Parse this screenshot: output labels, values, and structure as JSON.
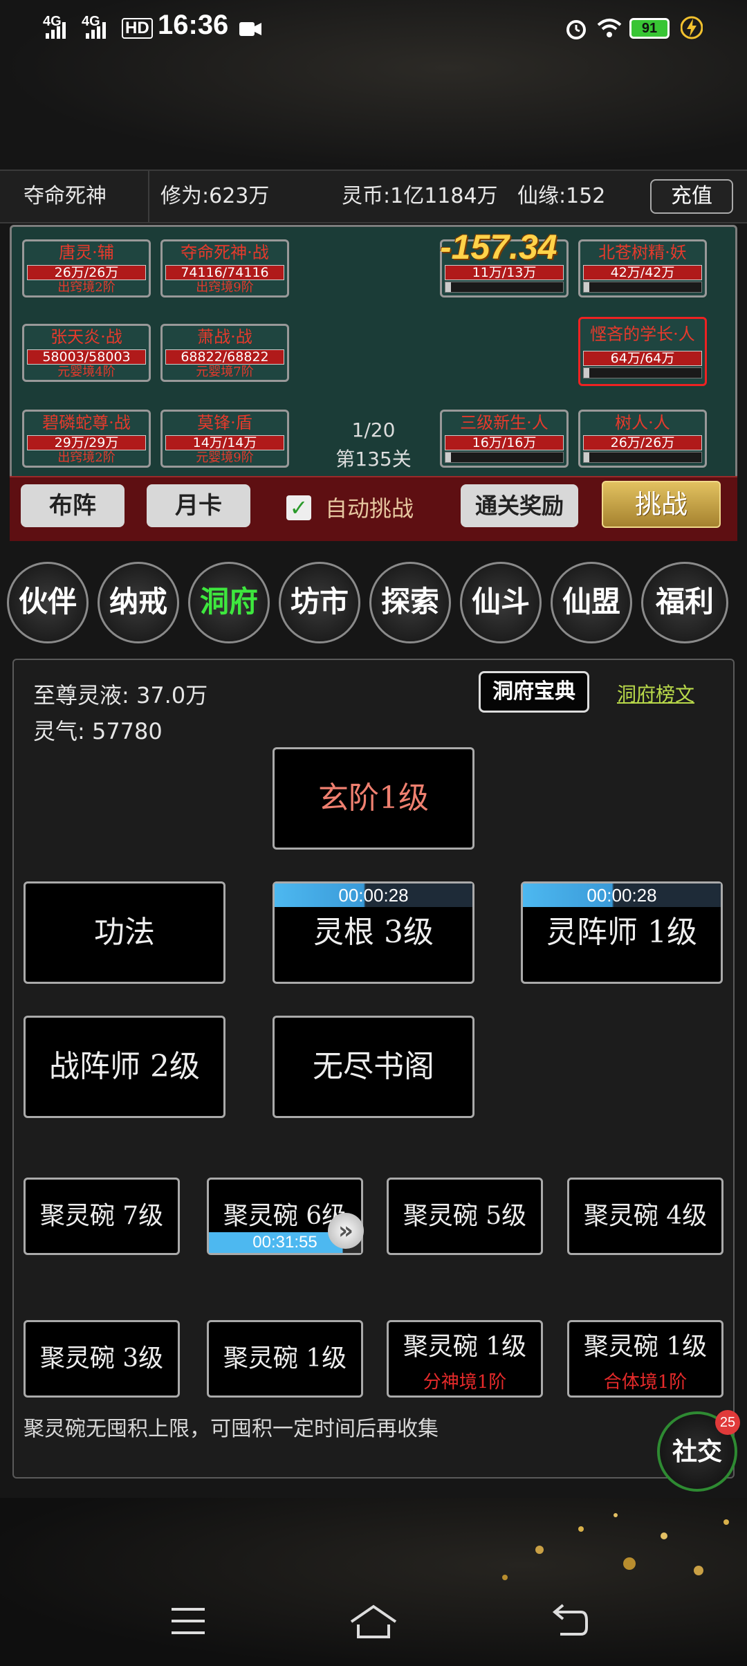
{
  "status_bar": {
    "time": "16:36",
    "net1": "4G",
    "net2": "4G",
    "hd": "HD",
    "battery": "91"
  },
  "info_bar": {
    "player_name": "夺命死神",
    "cultivation": "修为:623万",
    "spirit_coin": "灵币:1亿1184万",
    "fate": "仙缘:152",
    "recharge_label": "充值"
  },
  "battle": {
    "damage_number": "-157.34",
    "stage_count": "1/20",
    "stage_name": "第135关",
    "allies": [
      {
        "name": "唐灵·辅",
        "hp": "26万/26万",
        "realm": "出窍境2阶"
      },
      {
        "name": "夺命死神·战",
        "hp": "74116/74116",
        "realm": "出窍境9阶"
      },
      {
        "name": "张天炎·战",
        "hp": "58003/58003",
        "realm": "元婴境4阶"
      },
      {
        "name": "萧战·战",
        "hp": "68822/68822",
        "realm": "元婴境7阶"
      },
      {
        "name": "碧磷蛇尊·战",
        "hp": "29万/29万",
        "realm": "出窍境2阶"
      },
      {
        "name": "莫锋·盾",
        "hp": "14万/14万",
        "realm": "元婴境9阶"
      }
    ],
    "enemies": [
      {
        "name": "",
        "hp": "11万/13万"
      },
      {
        "name": "北苍树精·妖",
        "hp": "42万/42万"
      },
      {
        "name": "悭吝的学长·人",
        "hp": "64万/64万"
      },
      {
        "name": "三级新生·人",
        "hp": "16万/16万"
      },
      {
        "name": "树人·人",
        "hp": "26万/26万"
      }
    ],
    "toolbar": {
      "formation": "布阵",
      "monthly_card": "月卡",
      "auto_challenge": "自动挑战",
      "clear_reward": "通关奖励",
      "challenge": "挑战"
    }
  },
  "nav": [
    "伙伴",
    "纳戒",
    "洞府",
    "坊市",
    "探索",
    "仙斗",
    "仙盟",
    "福利"
  ],
  "cave": {
    "supreme_liquid": "至尊灵液: 37.0万",
    "spirit_qi": "灵气: 57780",
    "codex_button": "洞府宝典",
    "rank_link": "洞府榜文",
    "tier": "玄阶1级",
    "gongfa": "功法",
    "spirit_root": "灵根 3级",
    "spirit_root_timer": "00:00:28",
    "array_master": "灵阵师 1级",
    "array_master_timer": "00:00:28",
    "battle_array_master": "战阵师 2级",
    "library": "无尽书阁",
    "bowls": [
      {
        "label": "聚灵碗 7级"
      },
      {
        "label": "聚灵碗 6级",
        "timer": "00:31:55"
      },
      {
        "label": "聚灵碗 5级"
      },
      {
        "label": "聚灵碗 4级"
      },
      {
        "label": "聚灵碗 3级"
      },
      {
        "label": "聚灵碗 1级"
      },
      {
        "label": "聚灵碗 1级",
        "sub": "分神境1阶"
      },
      {
        "label": "聚灵碗 1级",
        "sub": "合体境1阶"
      }
    ],
    "hint": "聚灵碗无囤积上限，可囤积一定时间后再收集",
    "social_label": "社交",
    "social_badge": "25"
  },
  "colors": {
    "accent_green": "#3ee83e",
    "enemy_red": "#e63a2c",
    "battle_bg": "#1b3c37",
    "gold": "#d9b456"
  }
}
